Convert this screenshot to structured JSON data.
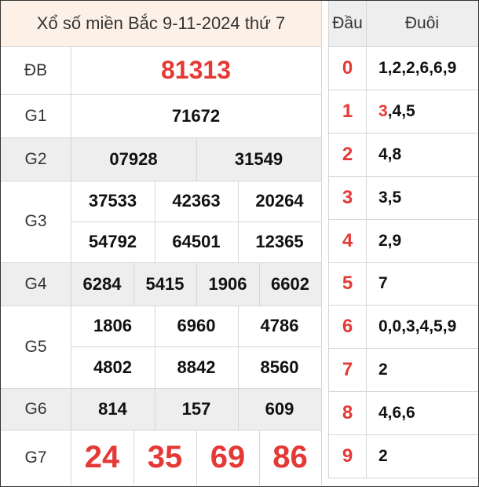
{
  "title": "Xổ số miền Bắc 9-11-2024 thứ 7",
  "prizes": {
    "db": {
      "label": "ĐB",
      "numbers": [
        "81313"
      ]
    },
    "g1": {
      "label": "G1",
      "numbers": [
        "71672"
      ]
    },
    "g2": {
      "label": "G2",
      "numbers": [
        "07928",
        "31549"
      ]
    },
    "g3": {
      "label": "G3",
      "numbers": [
        "37533",
        "42363",
        "20264",
        "54792",
        "64501",
        "12365"
      ]
    },
    "g4": {
      "label": "G4",
      "numbers": [
        "6284",
        "5415",
        "1906",
        "6602"
      ]
    },
    "g5": {
      "label": "G5",
      "numbers": [
        "1806",
        "6960",
        "4786",
        "4802",
        "8842",
        "8560"
      ]
    },
    "g6": {
      "label": "G6",
      "numbers": [
        "814",
        "157",
        "609"
      ]
    },
    "g7": {
      "label": "G7",
      "numbers": [
        "24",
        "35",
        "69",
        "86"
      ]
    }
  },
  "loto": {
    "head_label": "Đầu",
    "tail_label": "Đuôi",
    "rows": [
      {
        "head": "0",
        "tail_red": "",
        "tail": "1,2,2,6,6,9"
      },
      {
        "head": "1",
        "tail_red": "3",
        "tail": ",4,5"
      },
      {
        "head": "2",
        "tail_red": "",
        "tail": "4,8"
      },
      {
        "head": "3",
        "tail_red": "",
        "tail": "3,5"
      },
      {
        "head": "4",
        "tail_red": "",
        "tail": "2,9"
      },
      {
        "head": "5",
        "tail_red": "",
        "tail": "7"
      },
      {
        "head": "6",
        "tail_red": "",
        "tail": "0,0,3,4,5,9"
      },
      {
        "head": "7",
        "tail_red": "",
        "tail": "2"
      },
      {
        "head": "8",
        "tail_red": "",
        "tail": "4,6,6"
      },
      {
        "head": "9",
        "tail_red": "",
        "tail": "2"
      }
    ]
  }
}
